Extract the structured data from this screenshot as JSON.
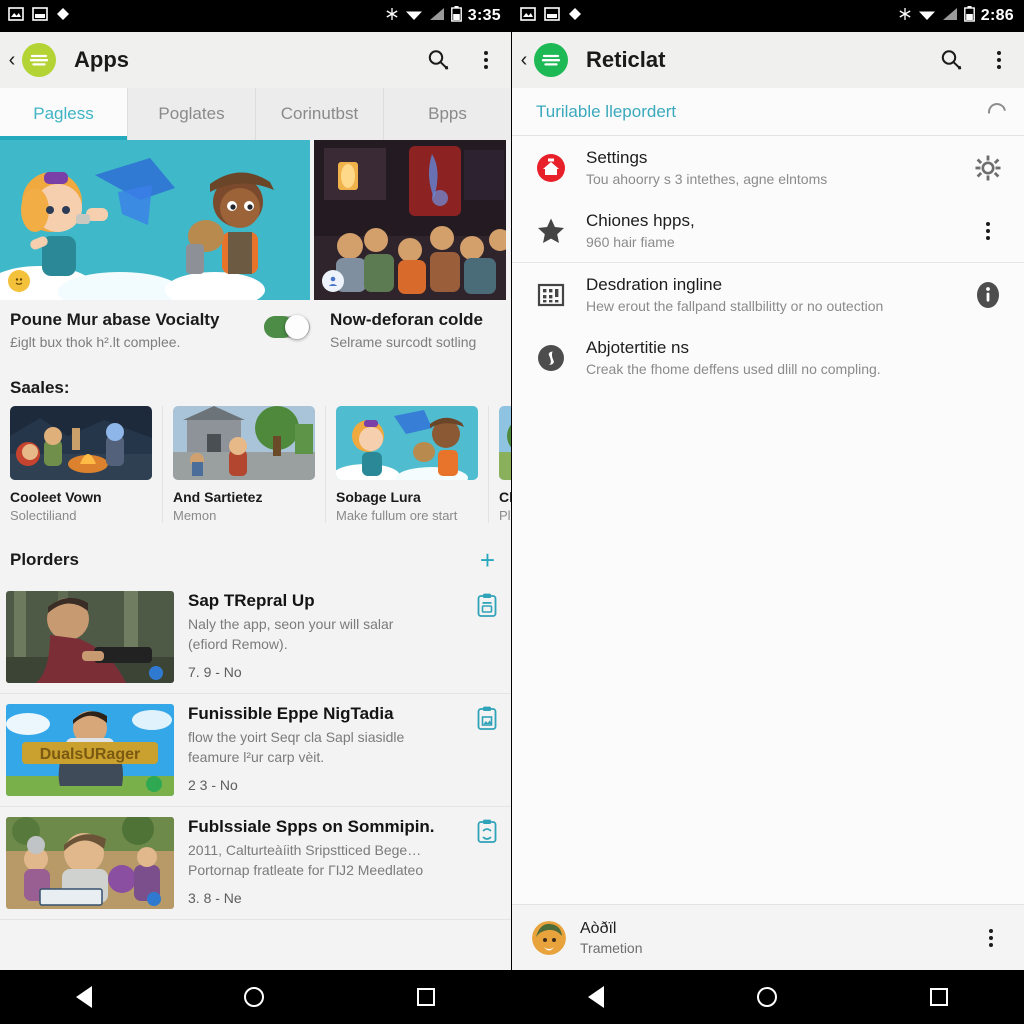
{
  "left": {
    "status_bar": {
      "time": "3:35",
      "icons": [
        "image-icon",
        "photo-icon",
        "diamond-icon",
        "snowflake-icon",
        "wifi-icon",
        "signal-icon",
        "battery-icon"
      ]
    },
    "app_bar": {
      "back": "‹",
      "brand_icon": "lime-wave-icon",
      "brand_color": "#b4d335",
      "title": "Apps",
      "search": "search-icon",
      "overflow": "more-vert-icon"
    },
    "tabs": [
      {
        "label": "Pagless",
        "active": true
      },
      {
        "label": "Poglates",
        "active": false
      },
      {
        "label": "Corinutbst",
        "active": false
      },
      {
        "label": "Bpps",
        "active": false
      }
    ],
    "tab_accent": "#24a9bd",
    "hero": {
      "main_badge": "emoji-badge",
      "side_badge": "user-badge",
      "left_card": {
        "title": "Poune Mur abase Vocialty",
        "subtitle": "£iglt bux thok h².lt complee.",
        "toggle_on": true
      },
      "right_card": {
        "title": "Now-deforan colde",
        "subtitle": "Selrame surcodt sotling"
      }
    },
    "sales": {
      "heading": "Saales:",
      "cards": [
        {
          "title": "Cooleet Vown",
          "subtitle": "Solectiliand"
        },
        {
          "title": "And Sartietez",
          "subtitle": "Memon"
        },
        {
          "title": "Sobage Lura",
          "subtitle": "Make fullum ore start"
        },
        {
          "title": "Cl",
          "subtitle": "Pl•"
        }
      ]
    },
    "orders": {
      "heading": "Plorders",
      "add_label": "+",
      "items": [
        {
          "title": "Sap TRepral Up",
          "desc1": "Naly the app, seon your will salar",
          "desc2": "(efiord Remow).",
          "meta": "7. 9 - No",
          "action_icon": "clipboard-icon"
        },
        {
          "title": "Funissible Eppe NigTadia",
          "desc1": "flow the yoirt Seqr cla Sapl siasidle",
          "desc2": "feamure l²ur carp vèit.",
          "meta": "2 3 - No",
          "action_icon": "clipboard-image-icon"
        },
        {
          "title": "Fublssiale Spps on Sommipin.",
          "desc1": "2011, Calturteàíith Sripstticed Bege…",
          "desc2": "Portornap fratleate for ΓĲ2 Meedlateo",
          "meta": "3. 8 - Ne",
          "action_icon": "clipboard-sync-icon"
        }
      ]
    },
    "nav": [
      "back-triangle-icon",
      "home-circle-icon",
      "recents-square-icon"
    ]
  },
  "right": {
    "status_bar": {
      "time": "2:86",
      "icons": [
        "image-icon",
        "photo-icon",
        "diamond-icon",
        "snowflake-icon",
        "wifi-icon",
        "signal-icon",
        "battery-icon"
      ]
    },
    "app_bar": {
      "back": "‹",
      "brand_icon": "green-wave-icon",
      "brand_color": "#1db954",
      "title": "Reticlat",
      "search": "search-icon",
      "overflow": "more-vert-icon"
    },
    "subheader": {
      "text": "Turilable llepordert",
      "spinner": "loading-spinner-icon"
    },
    "items": [
      {
        "icon": "red-home-icon",
        "title": "Settings",
        "subtitle": "Tou ahoorry s 3 intethes, agne elntoms",
        "action": "gear-icon"
      },
      {
        "icon": "star-icon",
        "title": "Chiones hpps,",
        "subtitle": "960 hair fiame",
        "action": "more-vert-icon"
      },
      {
        "icon": "grid-calculator-icon",
        "title": "Desdration ingline",
        "subtitle": "Hew erout the fallpand stallbilitty or no outection",
        "action": "info-badge-icon"
      },
      {
        "icon": "info-circle-icon",
        "title": "Abjotertitie ns",
        "subtitle": "Creak the fhome deffens used dlill no compling.",
        "action": ""
      }
    ],
    "footer": {
      "avatar": "user-avatar",
      "title": "Aòðïl",
      "subtitle": "Trametion",
      "action": "more-vert-icon"
    },
    "nav": [
      "back-triangle-icon",
      "home-circle-icon",
      "recents-square-icon"
    ]
  }
}
